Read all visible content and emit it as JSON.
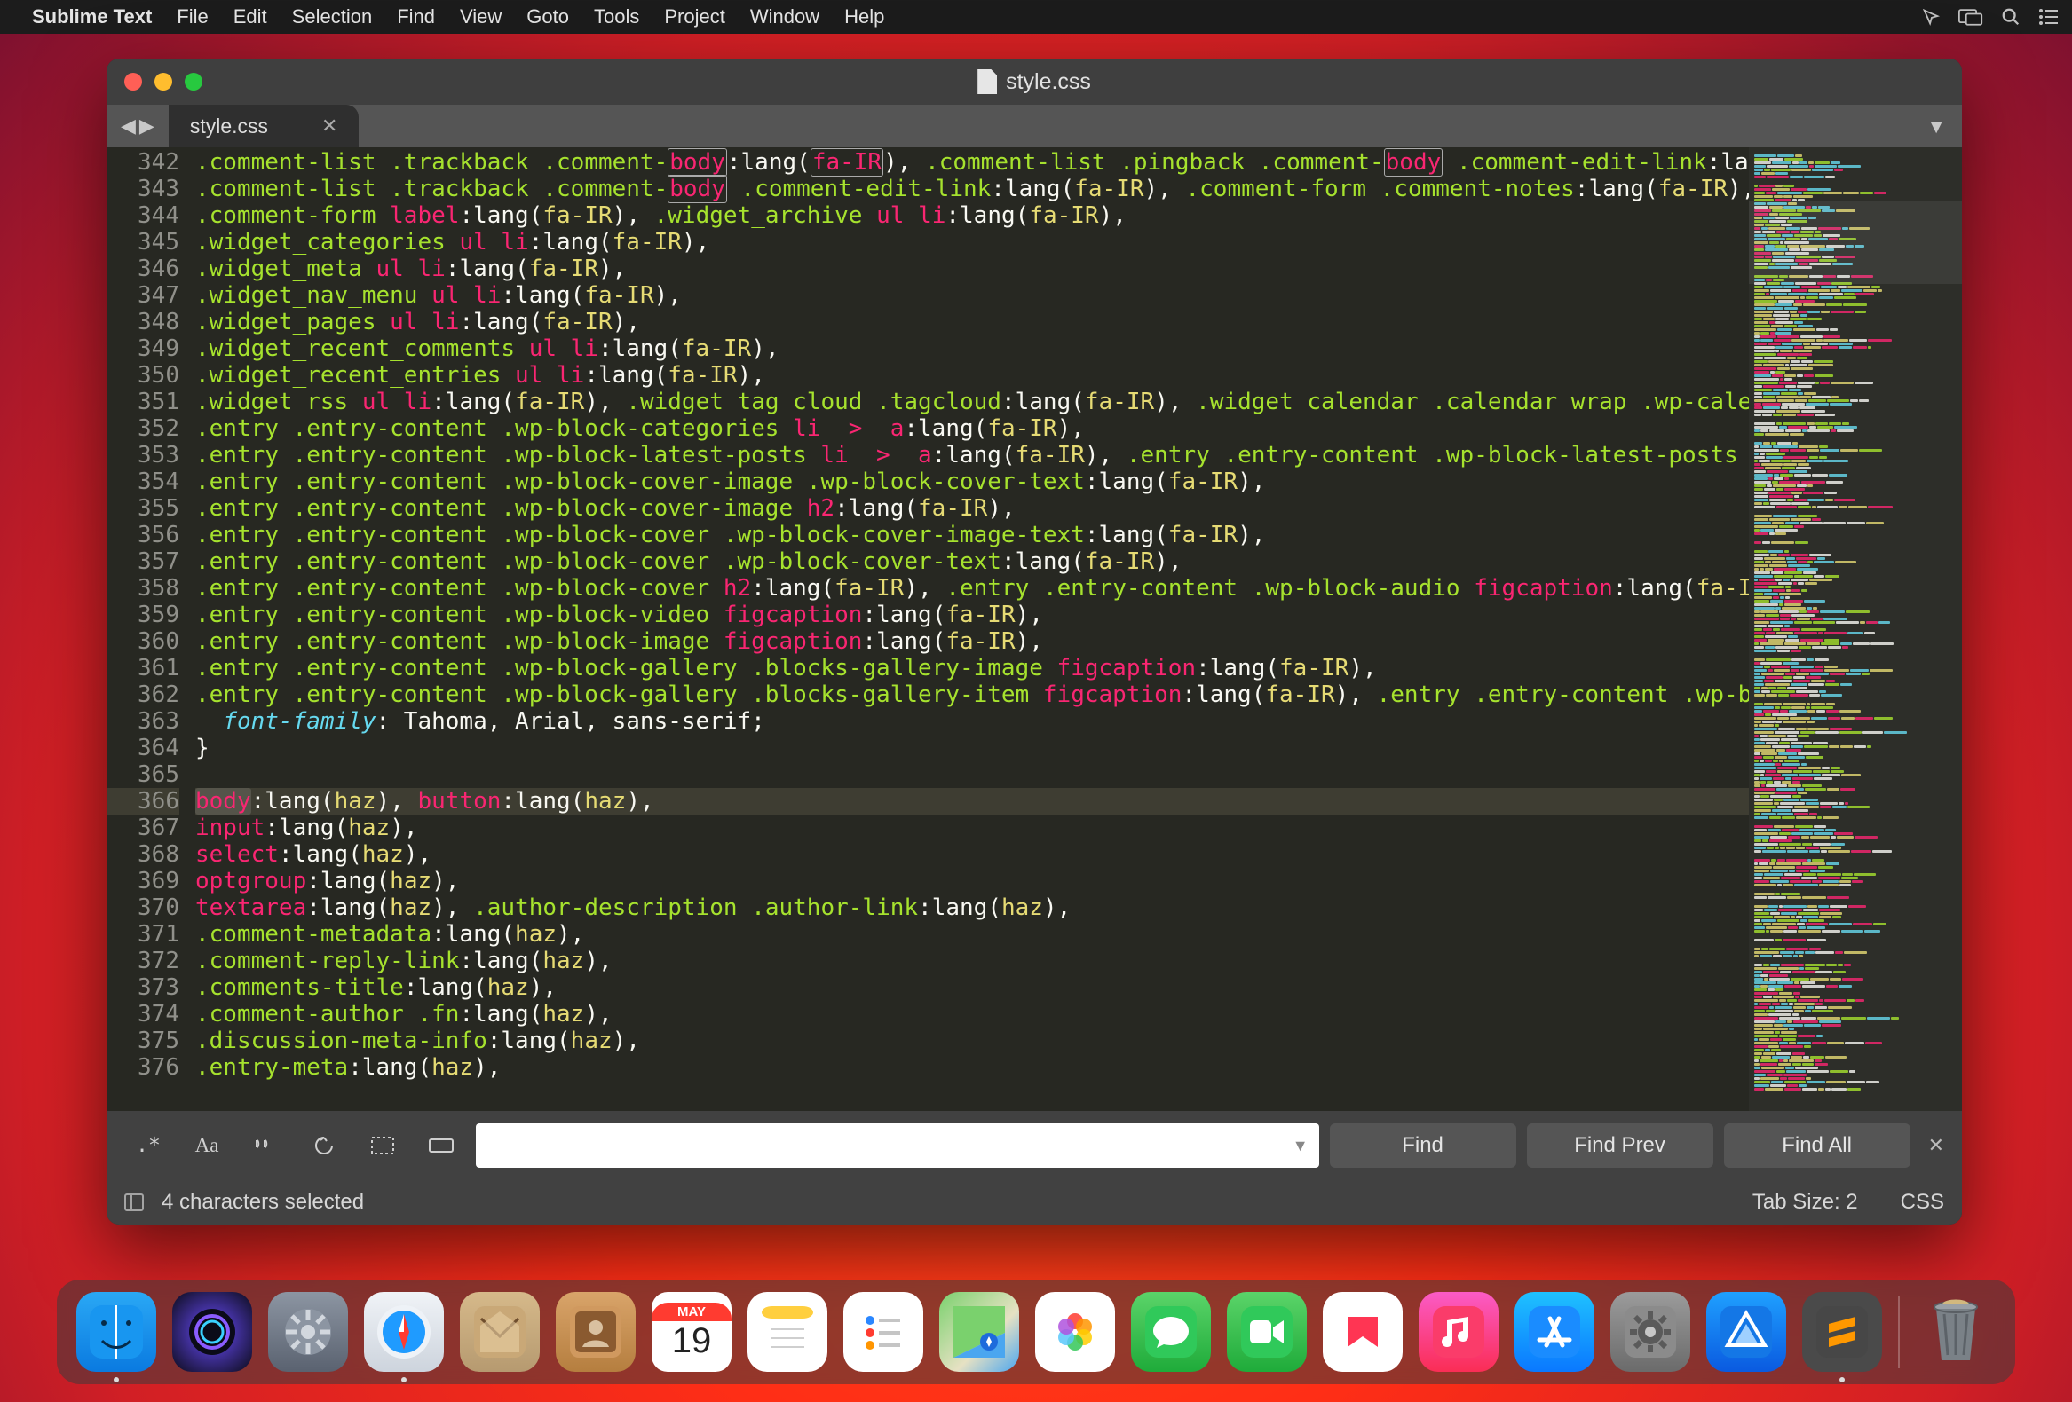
{
  "menubar": {
    "app_name": "Sublime Text",
    "menus": [
      "File",
      "Edit",
      "Selection",
      "Find",
      "View",
      "Goto",
      "Tools",
      "Project",
      "Window",
      "Help"
    ]
  },
  "window": {
    "title": "style.css",
    "tab": {
      "label": "style.css"
    }
  },
  "gutter_start": 342,
  "gutter_end": 376,
  "highlighted_line": 366,
  "code": {
    "l342": ".comment-list .trackback .comment-|body|:lang(|fa-IR|), .comment-list .pingback .comment-|body| .comment-edit-link:lang(|fa-IR|)",
    "l343": ".comment-list .trackback .comment-|body| .comment-edit-link:lang(fa-IR), .comment-form .comment-notes:lang(fa-IR),",
    "l344": ".comment-form label:lang(fa-IR), .widget_archive ul li:lang(fa-IR),",
    "l345": ".widget_categories ul li:lang(fa-IR),",
    "l346": ".widget_meta ul li:lang(fa-IR),",
    "l347": ".widget_nav_menu ul li:lang(fa-IR),",
    "l348": ".widget_pages ul li:lang(fa-IR),",
    "l349": ".widget_recent_comments ul li:lang(fa-IR),",
    "l350": ".widget_recent_entries ul li:lang(fa-IR),",
    "l351": ".widget_rss ul li:lang(fa-IR), .widget_tag_cloud .tagcloud:lang(fa-IR), .widget_calendar .calendar_wrap .wp-calendar-nav",
    "l352": ".entry .entry-content .wp-block-categories li > a:lang(fa-IR),",
    "l353": ".entry .entry-content .wp-block-latest-posts li > a:lang(fa-IR), .entry .entry-content .wp-block-latest-posts .wp-block-",
    "l354": ".entry .entry-content .wp-block-cover-image .wp-block-cover-text:lang(fa-IR),",
    "l355": ".entry .entry-content .wp-block-cover-image h2:lang(fa-IR),",
    "l356": ".entry .entry-content .wp-block-cover .wp-block-cover-image-text:lang(fa-IR),",
    "l357": ".entry .entry-content .wp-block-cover .wp-block-cover-text:lang(fa-IR),",
    "l358": ".entry .entry-content .wp-block-cover h2:lang(fa-IR), .entry .entry-content .wp-block-audio figcaption:lang(fa-IR),",
    "l359": ".entry .entry-content .wp-block-video figcaption:lang(fa-IR),",
    "l360": ".entry .entry-content .wp-block-image figcaption:lang(fa-IR),",
    "l361": ".entry .entry-content .wp-block-gallery .blocks-gallery-image figcaption:lang(fa-IR),",
    "l362": ".entry .entry-content .wp-block-gallery .blocks-gallery-item figcaption:lang(fa-IR), .entry .entry-content .wp-block-fil",
    "l363": "  font-family: Tahoma, Arial, sans-serif;",
    "l364": "}",
    "l365": "",
    "l366": "body:lang(haz), button:lang(haz),",
    "l367": "input:lang(haz),",
    "l368": "select:lang(haz),",
    "l369": "optgroup:lang(haz),",
    "l370": "textarea:lang(haz), .author-description .author-link:lang(haz),",
    "l371": ".comment-metadata:lang(haz),",
    "l372": ".comment-reply-link:lang(haz),",
    "l373": ".comments-title:lang(haz),",
    "l374": ".comment-author .fn:lang(haz),",
    "l375": ".discussion-meta-info:lang(haz),",
    "l376": ".entry-meta:lang(haz),"
  },
  "findbar": {
    "buttons": {
      "regex": ".*",
      "case": "Aa",
      "whole": "“ ”",
      "wrap": "↻≡",
      "insel": "▭",
      "highlight": "▭"
    },
    "input_value": "",
    "find": "Find",
    "find_prev": "Find Prev",
    "find_all": "Find All"
  },
  "statusbar": {
    "selection": "4 characters selected",
    "tab_size": "Tab Size: 2",
    "syntax": "CSS"
  },
  "dock": {
    "calendar": {
      "month": "MAY",
      "day": "19"
    },
    "apps": [
      "finder",
      "siri",
      "launchpad",
      "safari",
      "mail",
      "contacts",
      "calendar",
      "notes",
      "reminders",
      "maps",
      "photos",
      "messages",
      "facetime",
      "news",
      "music",
      "appstore",
      "prefs",
      "xcode",
      "sublime"
    ],
    "trash": "trash"
  }
}
